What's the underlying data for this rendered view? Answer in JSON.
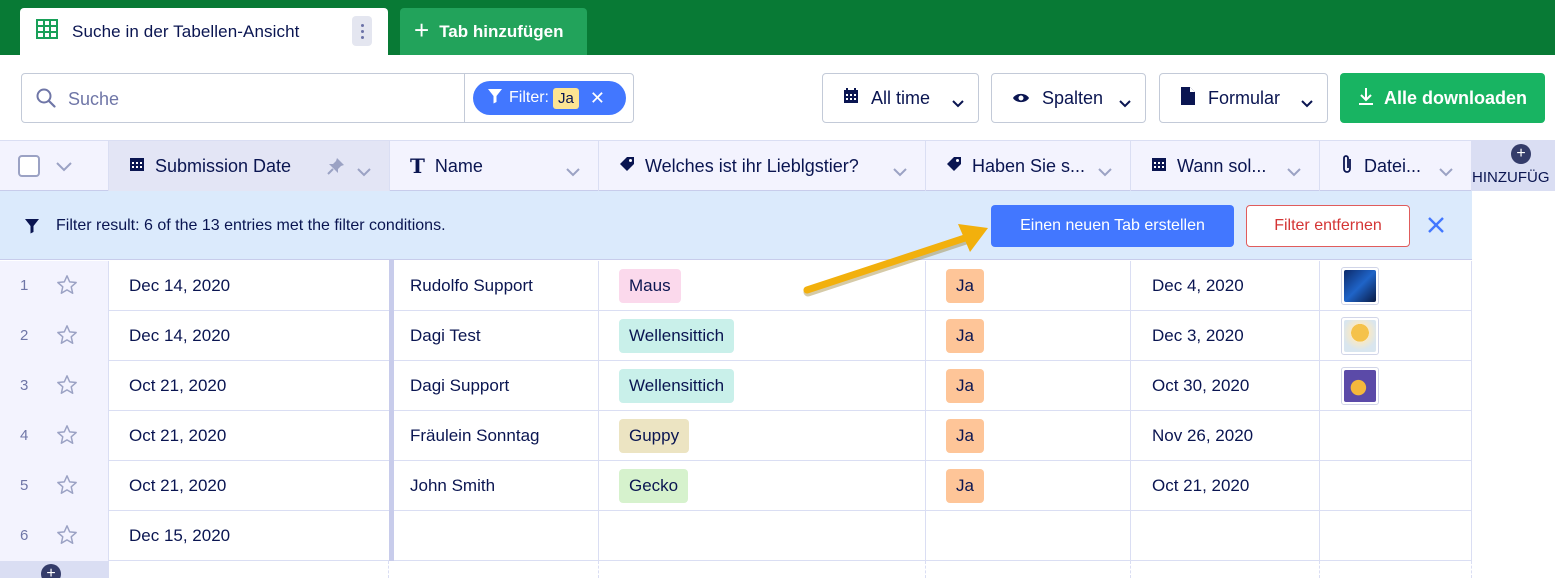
{
  "tabs": {
    "active_label": "Suche in der Tabellen-Ansicht",
    "add_label": "Tab hinzufügen"
  },
  "toolbar": {
    "search_placeholder": "Suche",
    "filter_label": "Filter:",
    "filter_value": "Ja",
    "date_range": "All time",
    "columns": "Spalten",
    "form": "Formular",
    "download_all": "Alle downloaden"
  },
  "header": {
    "columns": [
      {
        "label": "Submission Date",
        "icon": "calendar-icon"
      },
      {
        "label": "Name",
        "icon": "text-icon"
      },
      {
        "label": "Welches ist ihr Lieblgstier?",
        "icon": "tag-icon"
      },
      {
        "label": "Haben Sie s...",
        "icon": "tag-icon"
      },
      {
        "label": "Wann sol...",
        "icon": "calendar-icon"
      },
      {
        "label": "Datei...",
        "icon": "paperclip-icon"
      }
    ],
    "add_column": "HINZUFÜG"
  },
  "banner": {
    "text": "Filter result: 6 of the 13 entries met the filter conditions.",
    "new_tab_button": "Einen neuen Tab erstellen",
    "remove_filter_button": "Filter entfernen"
  },
  "rows": [
    {
      "num": "1",
      "date": "Dec 14, 2020",
      "name": "Rudolfo Support",
      "pet": "Maus",
      "pet_color": "#fbd9ec",
      "answer": "Ja",
      "when": "Dec 4, 2020",
      "file": "photo-dark"
    },
    {
      "num": "2",
      "date": "Dec 14, 2020",
      "name": "Dagi Test",
      "pet": "Wellensittich",
      "pet_color": "#c9f0ea",
      "answer": "Ja",
      "when": "Dec 3, 2020",
      "file": "photo-sun"
    },
    {
      "num": "3",
      "date": "Oct 21, 2020",
      "name": "Dagi Support",
      "pet": "Wellensittich",
      "pet_color": "#c9f0ea",
      "answer": "Ja",
      "when": "Oct 30, 2020",
      "file": "photo-purple"
    },
    {
      "num": "4",
      "date": "Oct 21, 2020",
      "name": "Fräulein Sonntag",
      "pet": "Guppy",
      "pet_color": "#ece4c2",
      "answer": "Ja",
      "when": "Nov 26, 2020",
      "file": ""
    },
    {
      "num": "5",
      "date": "Oct 21, 2020",
      "name": "John Smith",
      "pet": "Gecko",
      "pet_color": "#d6f2cd",
      "answer": "Ja",
      "when": "Oct 21, 2020",
      "file": ""
    },
    {
      "num": "6",
      "date": "Dec 15, 2020",
      "name": "",
      "pet": "",
      "pet_color": "",
      "answer": "",
      "when": "",
      "file": ""
    }
  ],
  "colors": {
    "topbar": "#087a35",
    "accent_blue": "#4277ff",
    "download_green": "#18b462",
    "annotation_arrow": "#f2b00c"
  }
}
